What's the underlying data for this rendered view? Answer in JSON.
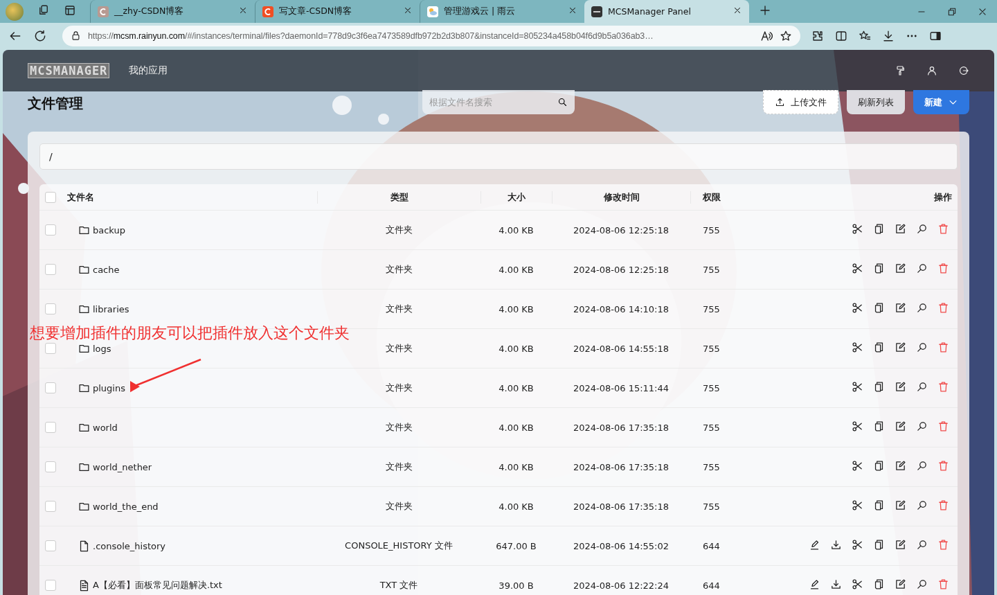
{
  "browser": {
    "tabs": [
      {
        "title": "__zhy-CSDN博客",
        "selected": false
      },
      {
        "title": "写文章-CSDN博客",
        "selected": false
      },
      {
        "title": "管理游戏云 | 雨云",
        "selected": false
      },
      {
        "title": "MCSManager Panel",
        "selected": true
      }
    ],
    "url": {
      "scheme": "https://",
      "host": "mcsm.rainyun.com",
      "rest": "/#/instances/terminal/files?daemonId=778d9c3f6ea7473589dfb972b2d3b807&instanceId=805234a458b04f6d9b5a036ab3…"
    }
  },
  "header": {
    "logo": "MCSMANAGER",
    "nav": "我的应用"
  },
  "page": {
    "title": "文件管理",
    "search": {
      "placeholder": "根据文件名搜索"
    },
    "buttons": [
      {
        "label": "上传文件",
        "kind": "upload"
      },
      {
        "label": "刷新列表",
        "kind": "plain"
      },
      {
        "label": "新建",
        "kind": "primary"
      }
    ],
    "path": "/"
  },
  "table": {
    "select_all": {
      "checked": false
    },
    "columns": [
      "文件名",
      "类型",
      "大小",
      "修改时间",
      "权限",
      "操作"
    ],
    "rows": [
      {
        "kind": "folder",
        "checked": false,
        "name": "backup",
        "type": "文件夹",
        "size": "4.00 KB",
        "modified": "2024-08-06 12:25:18",
        "permission": "755"
      },
      {
        "kind": "folder",
        "checked": false,
        "name": "cache",
        "type": "文件夹",
        "size": "4.00 KB",
        "modified": "2024-08-06 12:25:18",
        "permission": "755"
      },
      {
        "kind": "folder",
        "checked": false,
        "name": "libraries",
        "type": "文件夹",
        "size": "4.00 KB",
        "modified": "2024-08-06 14:10:18",
        "permission": "755"
      },
      {
        "kind": "folder",
        "checked": false,
        "name": "logs",
        "type": "文件夹",
        "size": "4.00 KB",
        "modified": "2024-08-06 14:55:18",
        "permission": "755"
      },
      {
        "kind": "folder",
        "checked": false,
        "name": "plugins",
        "type": "文件夹",
        "size": "4.00 KB",
        "modified": "2024-08-06 15:11:44",
        "permission": "755"
      },
      {
        "kind": "folder",
        "checked": false,
        "name": "world",
        "type": "文件夹",
        "size": "4.00 KB",
        "modified": "2024-08-06 17:35:18",
        "permission": "755"
      },
      {
        "kind": "folder",
        "checked": false,
        "name": "world_nether",
        "type": "文件夹",
        "size": "4.00 KB",
        "modified": "2024-08-06 17:35:18",
        "permission": "755"
      },
      {
        "kind": "folder",
        "checked": false,
        "name": "world_the_end",
        "type": "文件夹",
        "size": "4.00 KB",
        "modified": "2024-08-06 17:35:18",
        "permission": "755"
      },
      {
        "kind": "file",
        "checked": false,
        "name": ".console_history",
        "type": "CONSOLE_HISTORY 文件",
        "size": "647.00 B",
        "modified": "2024-08-06 14:55:02",
        "permission": "644"
      },
      {
        "kind": "text-file",
        "checked": false,
        "name": "A【必看】面板常见问题解决.txt",
        "type": "TXT 文件",
        "size": "39.00 B",
        "modified": "2024-08-06 12:22:24",
        "permission": "644"
      }
    ]
  },
  "annotation": {
    "text": "想要增加插件的朋友可以把插件放入这个文件夹"
  }
}
